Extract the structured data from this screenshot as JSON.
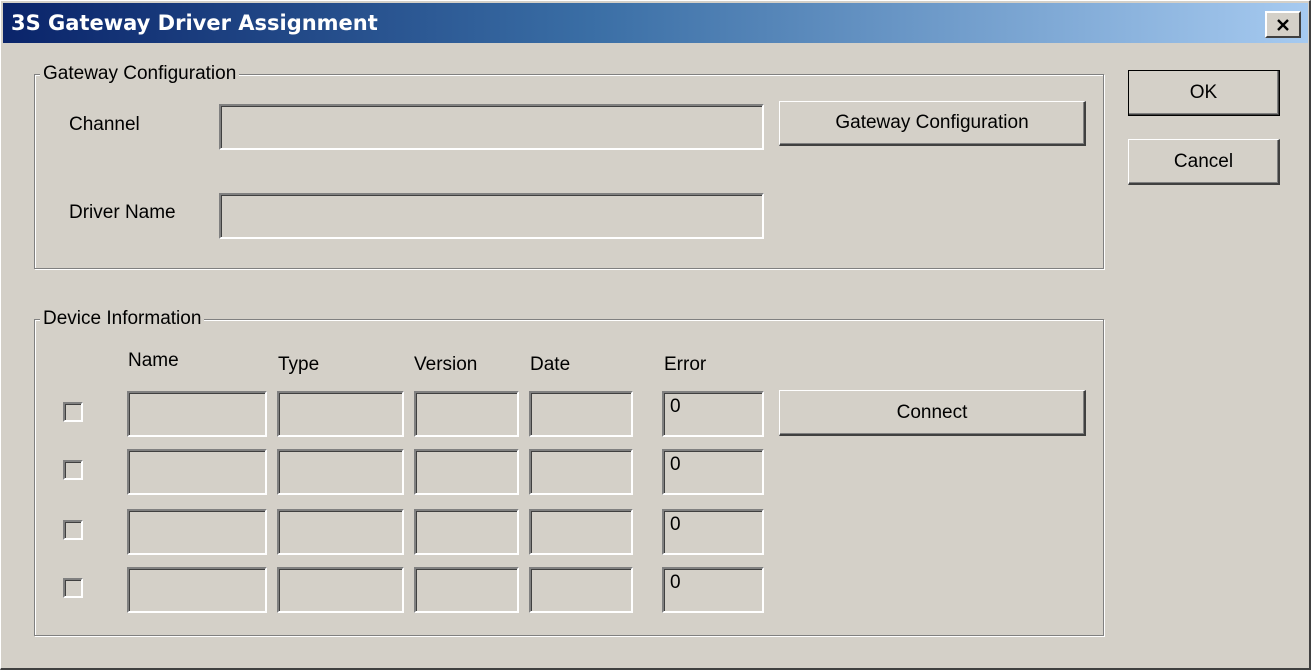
{
  "window": {
    "title": "3S Gateway  Driver Assignment",
    "close_symbol": "close-icon"
  },
  "gateway_configuration": {
    "legend": "Gateway Configuration",
    "channel_label": "Channel",
    "channel_value": "",
    "driver_name_label": "Driver Name",
    "driver_name_value": "",
    "gateway_config_button": "Gateway Configuration"
  },
  "device_information": {
    "legend": "Device Information",
    "columns": {
      "name": "Name",
      "type": "Type",
      "version": "Version",
      "date": "Date",
      "error": "Error"
    },
    "rows": [
      {
        "checked": false,
        "name": "",
        "type": "",
        "version": "",
        "date": "",
        "error": "0"
      },
      {
        "checked": false,
        "name": "",
        "type": "",
        "version": "",
        "date": "",
        "error": "0"
      },
      {
        "checked": false,
        "name": "",
        "type": "",
        "version": "",
        "date": "",
        "error": "0"
      },
      {
        "checked": false,
        "name": "",
        "type": "",
        "version": "",
        "date": "",
        "error": "0"
      }
    ],
    "connect_button": "Connect"
  },
  "actions": {
    "ok": "OK",
    "cancel": "Cancel"
  }
}
